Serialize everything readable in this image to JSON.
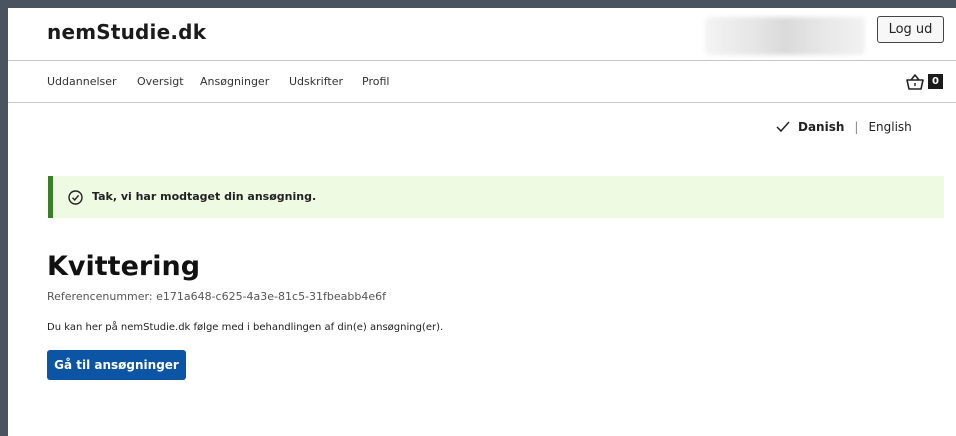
{
  "header": {
    "brand": "nemStudie.dk",
    "logout_label": "Log ud"
  },
  "nav": {
    "items": [
      "Uddannelser",
      "Oversigt",
      "Ansøgninger",
      "Udskrifter",
      "Profil"
    ],
    "basket_count": "0"
  },
  "language": {
    "active": "Danish",
    "separator": "|",
    "other": "English"
  },
  "alert": {
    "message": "Tak, vi har modtaget din ansøgning."
  },
  "main": {
    "title": "Kvittering",
    "reference": "Referencenummer: e171a648-c625-4a3e-81c5-31fbeabb4e6f",
    "info": "Du kan her på nemStudie.dk følge med i behandlingen af din(e) ansøgning(er).",
    "cta_label": "Gå til ansøgninger"
  },
  "colors": {
    "primary_button": "#0b55a4",
    "success_bg": "#eefae2",
    "success_border": "#3a7f28"
  }
}
